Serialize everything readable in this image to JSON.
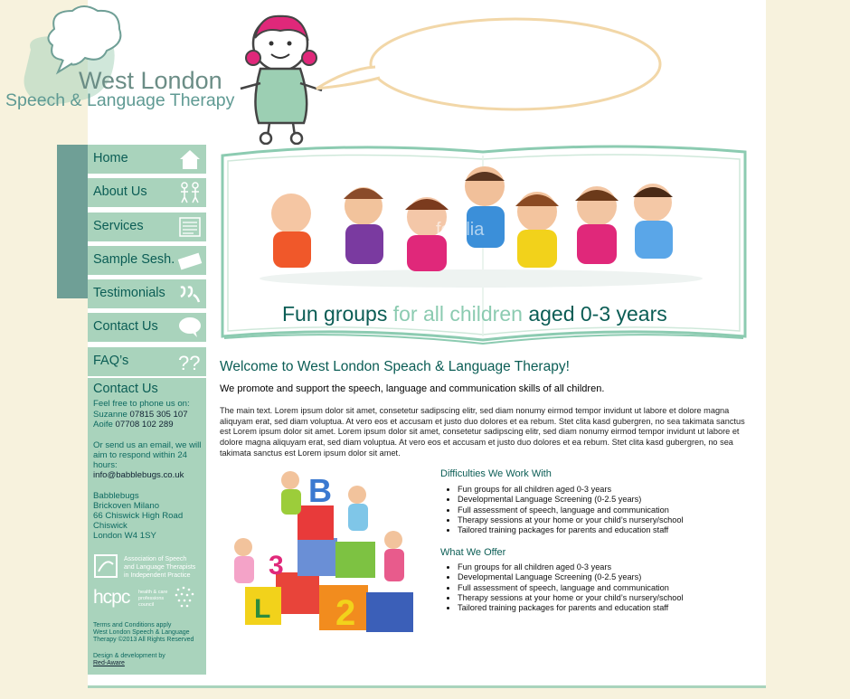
{
  "brand": {
    "line1": "West London",
    "line2": "Speech & Language Therapy"
  },
  "nav": {
    "items": [
      {
        "label": "Home",
        "icon": "home-icon"
      },
      {
        "label": "About Us",
        "icon": "people-icon"
      },
      {
        "label": "Services",
        "icon": "document-icon"
      },
      {
        "label": "Sample Sesh.",
        "icon": "ticket-icon"
      },
      {
        "label": "Testimonials",
        "icon": "quote-icon"
      },
      {
        "label": "Contact Us",
        "icon": "speech-bubble-icon"
      },
      {
        "label": "FAQ’s",
        "icon": "question-marks-icon"
      }
    ]
  },
  "hero": {
    "caption_part1": "Fun  groups ",
    "caption_part2": "for all children",
    "caption_part3": " aged 0-3 years",
    "watermark": "fotolia"
  },
  "contact": {
    "title": "Contact Us",
    "phone_intro": "Feel free to phone us on:",
    "phone1_name": "Suzanne",
    "phone1_number": "07815 305 107",
    "phone2_name": "Aoife",
    "phone2_number": "07708 102 289",
    "email_intro_1": "Or send us an email, we will",
    "email_intro_2": "aim to respond within 24",
    "email_intro_3": "hours:",
    "email": "info@babblebugs.co.uk",
    "address": [
      "Babblebugs",
      "Brickoven Milano",
      "66 Chiswick High Road",
      "Chiswick",
      "London W4 1SY"
    ],
    "assoc_text_1": "Association of Speech",
    "assoc_text_2": "and Language Therapists",
    "assoc_text_3": "in Independent Practice",
    "hcpc": "hcpc",
    "hcpc_small_1": "health & care",
    "hcpc_small_2": "professions",
    "hcpc_small_3": "council",
    "terms": "Terms and Conditions apply",
    "copyright_1": "West London Speech & Language",
    "copyright_2": "Therapy ©2013 All Rights Reserved",
    "design_credit": "Design & development by",
    "designer": "Red-Aware"
  },
  "main": {
    "welcome": "Welcome to West London Speach & Language Therapy!",
    "intro": "We promote and support the speech, language and communication skills of all children.",
    "body": "The main text. Lorem ipsum dolor sit amet, consetetur sadipscing elitr, sed diam nonumy eirmod tempor invidunt ut labore et dolore magna aliquyam erat, sed diam voluptua. At vero eos et accusam et justo duo dolores et ea rebum. Stet clita kasd gubergren, no sea takimata sanctus est Lorem ipsum dolor sit amet. Lorem ipsum dolor sit amet, consetetur sadipscing elitr, sed diam nonumy eirmod tempor invidunt ut labore et dolore magna aliquyam erat, sed diam voluptua. At vero eos et accusam et justo duo dolores et ea rebum. Stet clita kasd gubergren, no sea takimata sanctus est Lorem ipsum dolor sit amet.",
    "difficulties_title": "Difficulties We Work With",
    "difficulties": [
      "Fun  groups for all children aged 0-3 years",
      "Developmental Language Screening (0-2.5 years)",
      "Full assessment of speech, language and communication",
      "Therapy sessions at your home or your child’s nursery/school",
      "Tailored training packages for parents and education staff"
    ],
    "offer_title": "What We Offer",
    "offer": [
      "Fun  groups for all children aged 0-3 years",
      "Developmental Language Screening (0-2.5 years)",
      "Full assessment of speech, language and communication",
      "Therapy sessions at your home or your child’s nursery/school",
      "Tailored training packages for parents and education staff"
    ],
    "blocks_letters": [
      "B",
      "3",
      "L",
      "2"
    ]
  },
  "colors": {
    "accent": "#0b5d55",
    "nav_bg": "#a9d3bc",
    "nav_band": "#6f9f96",
    "page_bg": "#f7f2dd",
    "pink": "#e0287a"
  }
}
